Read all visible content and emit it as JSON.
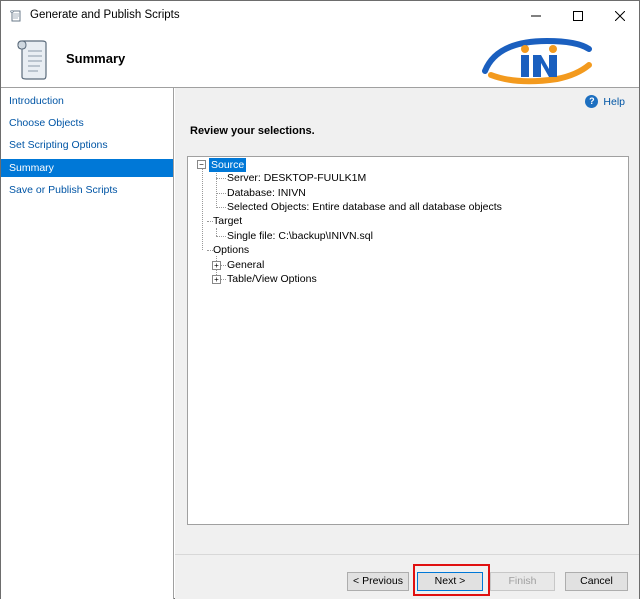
{
  "window": {
    "title": "Generate and Publish Scripts"
  },
  "header": {
    "title": "Summary",
    "logo_icon": "ini-logo"
  },
  "sidebar": {
    "items": [
      {
        "label": "Introduction",
        "selected": false
      },
      {
        "label": "Choose Objects",
        "selected": false
      },
      {
        "label": "Set Scripting Options",
        "selected": false
      },
      {
        "label": "Summary",
        "selected": true
      },
      {
        "label": "Save or Publish Scripts",
        "selected": false
      }
    ]
  },
  "main": {
    "help_label": "Help",
    "review_heading": "Review your selections.",
    "tree": {
      "source": {
        "label": "Source",
        "server": "Server: DESKTOP-FUULK1M",
        "database": "Database: INIVN",
        "selected_objects": "Selected Objects: Entire database and all database objects"
      },
      "target": {
        "label": "Target",
        "single_file": "Single file: C:\\backup\\INIVN.sql"
      },
      "options": {
        "label": "Options",
        "general": "General",
        "table_view": "Table/View Options"
      }
    }
  },
  "footer": {
    "previous_label": "< Previous",
    "next_label": "Next >",
    "finish_label": "Finish",
    "cancel_label": "Cancel"
  },
  "colors": {
    "accent": "#0078d7",
    "link": "#0055a5",
    "highlight": "#e01010"
  }
}
